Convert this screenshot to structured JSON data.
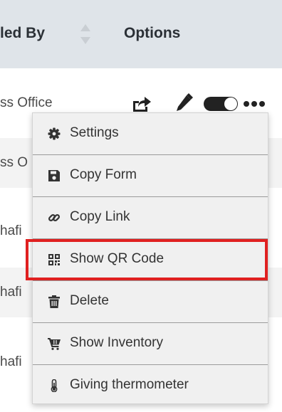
{
  "header": {
    "col_created_by": "led By",
    "col_options": "Options"
  },
  "rows": [
    {
      "text": "ss Office"
    },
    {
      "text": "ss O"
    },
    {
      "text": "hafi"
    },
    {
      "text": "hafi"
    },
    {
      "text": "hafi"
    }
  ],
  "row_options": {
    "icons": [
      "share-icon",
      "pencil-icon",
      "toggle-switch",
      "more-icon"
    ],
    "toggle_state": "on"
  },
  "menu": {
    "items": [
      {
        "label": "Settings",
        "icon": "gear-icon"
      },
      {
        "label": "Copy Form",
        "icon": "floppy-icon"
      },
      {
        "label": "Copy Link",
        "icon": "link-icon"
      },
      {
        "label": "Show QR Code",
        "icon": "qr-code-icon",
        "highlighted": true
      },
      {
        "label": "Delete",
        "icon": "trash-icon"
      },
      {
        "label": "Show Inventory",
        "icon": "cart-icon"
      },
      {
        "label": "Giving thermometer",
        "icon": "thermometer-icon"
      }
    ]
  },
  "colors": {
    "header_bg": "#dfe4e9",
    "menu_bg": "#f0f0f0",
    "highlight_border": "#e02020",
    "alt_row_bg": "#f3f3f3"
  }
}
